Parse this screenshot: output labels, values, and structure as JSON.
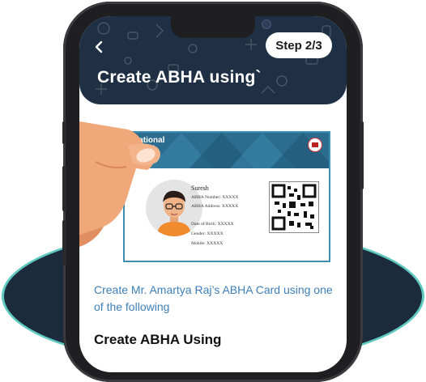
{
  "header": {
    "step_label": "Step 2/3",
    "title": "Create ABHA using`",
    "back_icon": "chevron-left-icon"
  },
  "card": {
    "logo_text": "National\nHealth",
    "name": "Suresh",
    "fields": [
      "ABHA Number: XXXXX",
      "ABHA Address: XXXXX",
      "Date of Birth: XXXXX",
      "Gender: XXXXX",
      "Mobile: XXXXX"
    ]
  },
  "body": {
    "instruction": "Create Mr. Amartya Raj’s ABHA Card using one of the following",
    "section_title": "Create ABHA Using"
  },
  "colors": {
    "header_bg": "#1f3044",
    "accent_text": "#3e7fb8",
    "backdrop_fill": "#1c2a3d",
    "backdrop_border": "#5ec9be"
  }
}
